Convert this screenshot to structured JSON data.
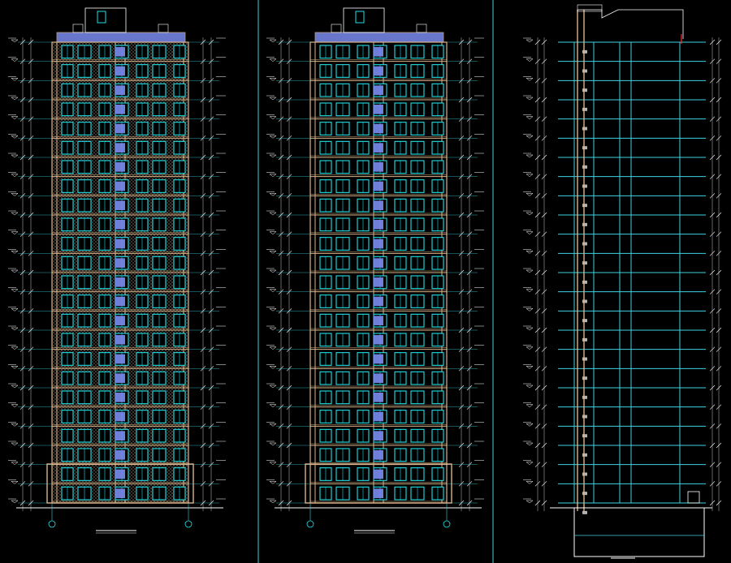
{
  "sheet": {
    "background": "#000000",
    "colors": {
      "frame": "#3fd2e0",
      "outline": "#d9b48a",
      "window": "#21e0e8",
      "glass": "#7b8cf0",
      "dim": "#c8c8c8",
      "white": "#ffffff",
      "accent": "#ff2a2a",
      "hatch": "#7a6a5a"
    },
    "floors": 24,
    "views": [
      {
        "id": "front-elevation",
        "kind": "elevation",
        "hatched_panels": true,
        "title": ""
      },
      {
        "id": "rear-elevation",
        "kind": "elevation",
        "hatched_panels": false,
        "title": ""
      },
      {
        "id": "section",
        "kind": "section",
        "title": ""
      }
    ]
  }
}
